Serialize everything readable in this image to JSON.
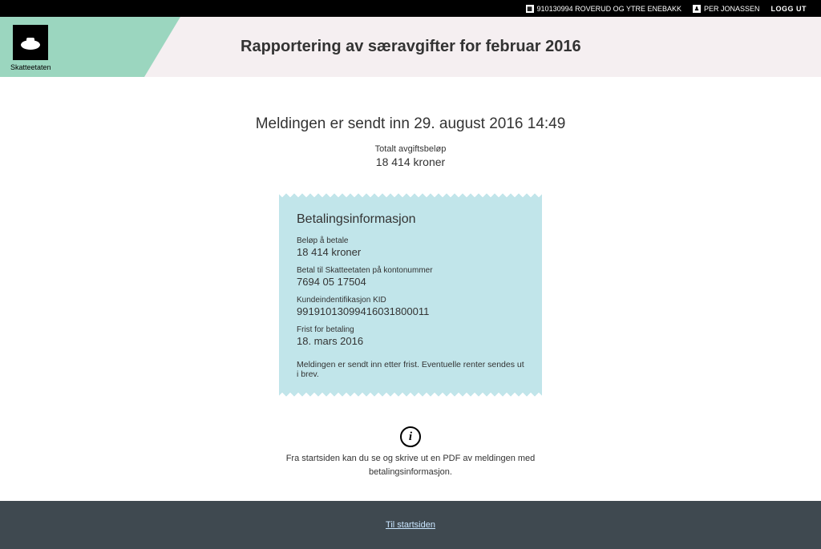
{
  "topbar": {
    "org_number_and_name": "910130994 ROVERUD OG YTRE ENEBAKK",
    "user_name": "PER JONASSEN",
    "logout_label": "LOGG UT"
  },
  "brand": {
    "name": "Skatteetaten"
  },
  "header": {
    "title": "Rapportering av særavgifter for februar 2016"
  },
  "status": {
    "sent_message": "Meldingen er sendt inn 29. august 2016 14:49",
    "total_label": "Totalt avgiftsbeløp",
    "total_value": "18 414 kroner"
  },
  "payment": {
    "heading": "Betalingsinformasjon",
    "amount_label": "Beløp å betale",
    "amount_value": "18 414 kroner",
    "account_label": "Betal til Skatteetaten på kontonummer",
    "account_value": "7694 05 17504",
    "kid_label": "Kundeindentifikasjon KID",
    "kid_value": "99191013099416031800011",
    "deadline_label": "Frist for betaling",
    "deadline_value": "18. mars 2016",
    "late_note": "Meldingen er sendt inn etter frist. Eventuelle renter sendes ut i brev."
  },
  "info": {
    "line1": "Fra startsiden kan du se og skrive ut en PDF av meldingen med",
    "line2": "betalingsinformasjon."
  },
  "footer": {
    "home_link": "Til startsiden"
  }
}
